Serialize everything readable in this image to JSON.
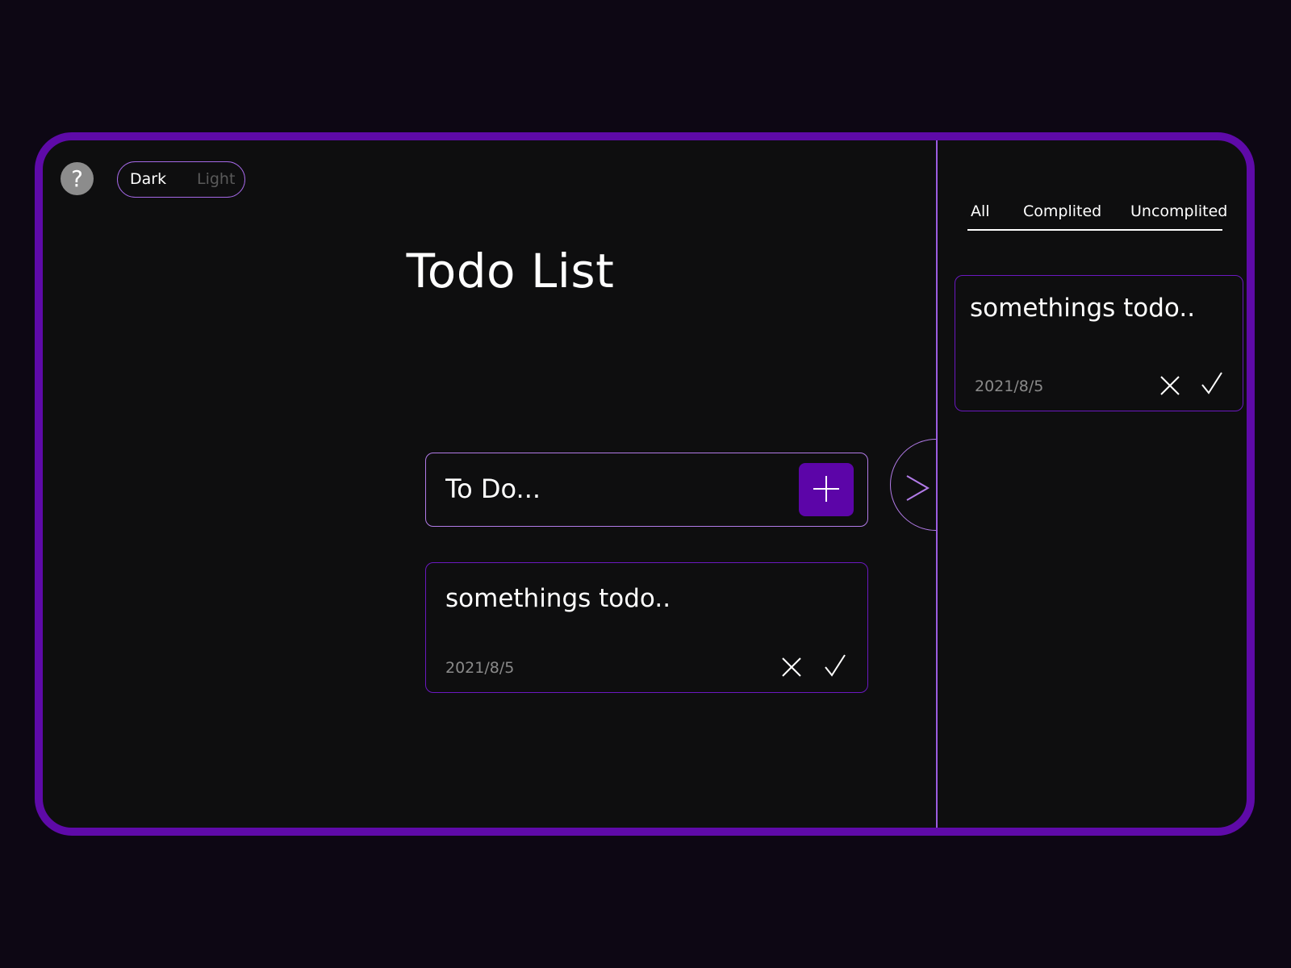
{
  "help": {
    "label": "?"
  },
  "theme": {
    "dark_label": "Dark",
    "light_label": "Light",
    "selected": "Dark"
  },
  "title": "Todo List",
  "input": {
    "placeholder": "To Do..."
  },
  "main_card": {
    "text": "somethings todo..",
    "date": "2021/8/5"
  },
  "filters": {
    "all": "All",
    "completed": "Complited",
    "uncompleted": "Uncomplited"
  },
  "side_card": {
    "text": "somethings todo..",
    "date": "2021/8/5"
  },
  "colors": {
    "accent": "#5e0aa8",
    "accent_light": "#b27be8",
    "background": "#0d0714",
    "panel": "#0e0e0f"
  },
  "icons": {
    "add": "plus-icon",
    "delete": "close-icon",
    "complete": "check-icon",
    "expand": "chevron-right-icon",
    "help": "question-icon"
  }
}
